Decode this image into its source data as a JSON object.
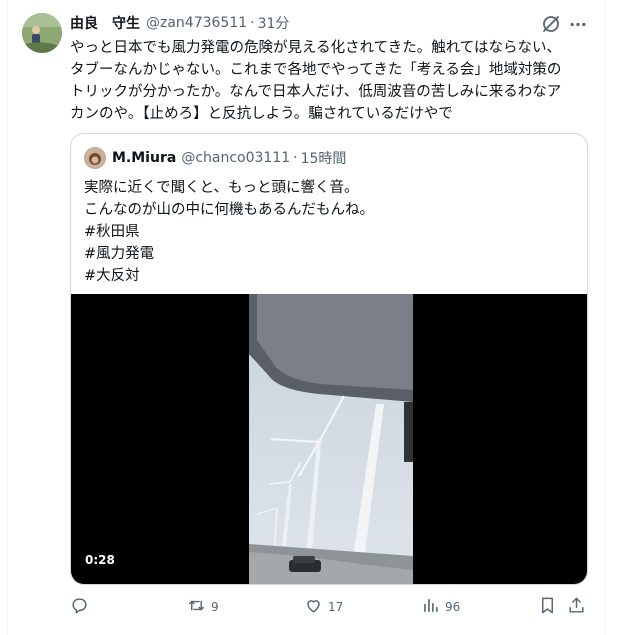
{
  "tweet": {
    "display_name": "由良　守生",
    "handle": "@zan4736511",
    "separator": "·",
    "time": "31分",
    "text": "やっと日本でも風力発電の危険が見える化されてきた。触れてはならない、\nタブーなんかじゃない。これまで各地でやってきた「考える会」地域対策の\nトリックが分かったか。なんで日本人だけ、低周波音の苦しみに来るわなア\nカンのや。【止めろ】と反抗しよう。騙されているだけやで"
  },
  "quoted": {
    "display_name": "M.Miura",
    "handle": "@chanco03111",
    "separator": "·",
    "time": "15時間",
    "text": "実際に近くで聞くと、もっと頭に響く音。\nこんなのが山の中に何機もあるんだもんね。\n#秋田県\n#風力発電\n#大反対",
    "video": {
      "duration": "0:28"
    }
  },
  "actions": {
    "reply": {
      "icon": "reply-icon",
      "count": ""
    },
    "retweet": {
      "icon": "retweet-icon",
      "count": "9"
    },
    "like": {
      "icon": "heart-icon",
      "count": "17"
    },
    "views": {
      "icon": "views-icon",
      "count": "96"
    },
    "bookmark": {
      "icon": "bookmark-icon"
    },
    "share": {
      "icon": "share-icon"
    }
  },
  "colors": {
    "text": "#0f1419",
    "secondary": "#536471",
    "border": "#cfd9de"
  }
}
